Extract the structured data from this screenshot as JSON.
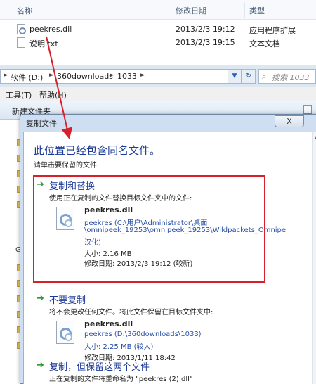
{
  "file_list": {
    "headers": {
      "name": "名称",
      "modified": "修改日期",
      "type": "类型"
    },
    "rows": [
      {
        "name": "peekres.dll",
        "modified": "2013/2/3 19:12",
        "type": "应用程序扩展",
        "icon": "dll-file-icon"
      },
      {
        "name": "说明.txt",
        "modified": "2013/2/3 19:15",
        "type": "文本文档",
        "icon": "text-file-icon"
      }
    ]
  },
  "address_bar": {
    "crumbs": [
      "软件 (D:)",
      "360downloads",
      "1033"
    ],
    "search_placeholder": "搜索 1033",
    "refresh_glyph": "↻"
  },
  "menu": {
    "tools": "工具(T)",
    "help": "帮助(H)"
  },
  "toolbar": {
    "new_folder": "新建文件夹"
  },
  "nav": {
    "letter": "G"
  },
  "dialog": {
    "title": "复制文件",
    "close_glyph": "X",
    "heading": "此位置已经包含同名文件。",
    "subtext": "请单击要保留的文件",
    "options": [
      {
        "title": "复制和替换",
        "description": "使用正在复制的文件替换目标文件夹中的文件:",
        "file_name": "peekres.dll",
        "path_lines": [
          "peekres (C:\\用户\\Administrator\\桌面",
          "\\omnipeek_19253\\omnipeek_19253\\Wildpackets_Omnipe",
          "汉化)"
        ],
        "size": "大小: 2.16 MB",
        "date": "修改日期: 2013/2/3 19:12 (较新)"
      },
      {
        "title": "不要复制",
        "description": "将不会更改任何文件。将此文件保留在目标文件夹中:",
        "file_name": "peekres.dll",
        "path_lines": [
          "peekres (D:\\360downloads\\1033)"
        ],
        "size": "大小: 2.25 MB (较大)",
        "date": "修改日期: 2013/1/11 18:42"
      },
      {
        "title": "复制，但保留这两个文件",
        "description": "正在复制的文件将重命名为 \"peekres (2).dll\""
      }
    ]
  },
  "colors": {
    "heading_blue": "#1c3a97",
    "highlight_red": "#d8202a",
    "arrow_green": "#2f9a2f"
  }
}
